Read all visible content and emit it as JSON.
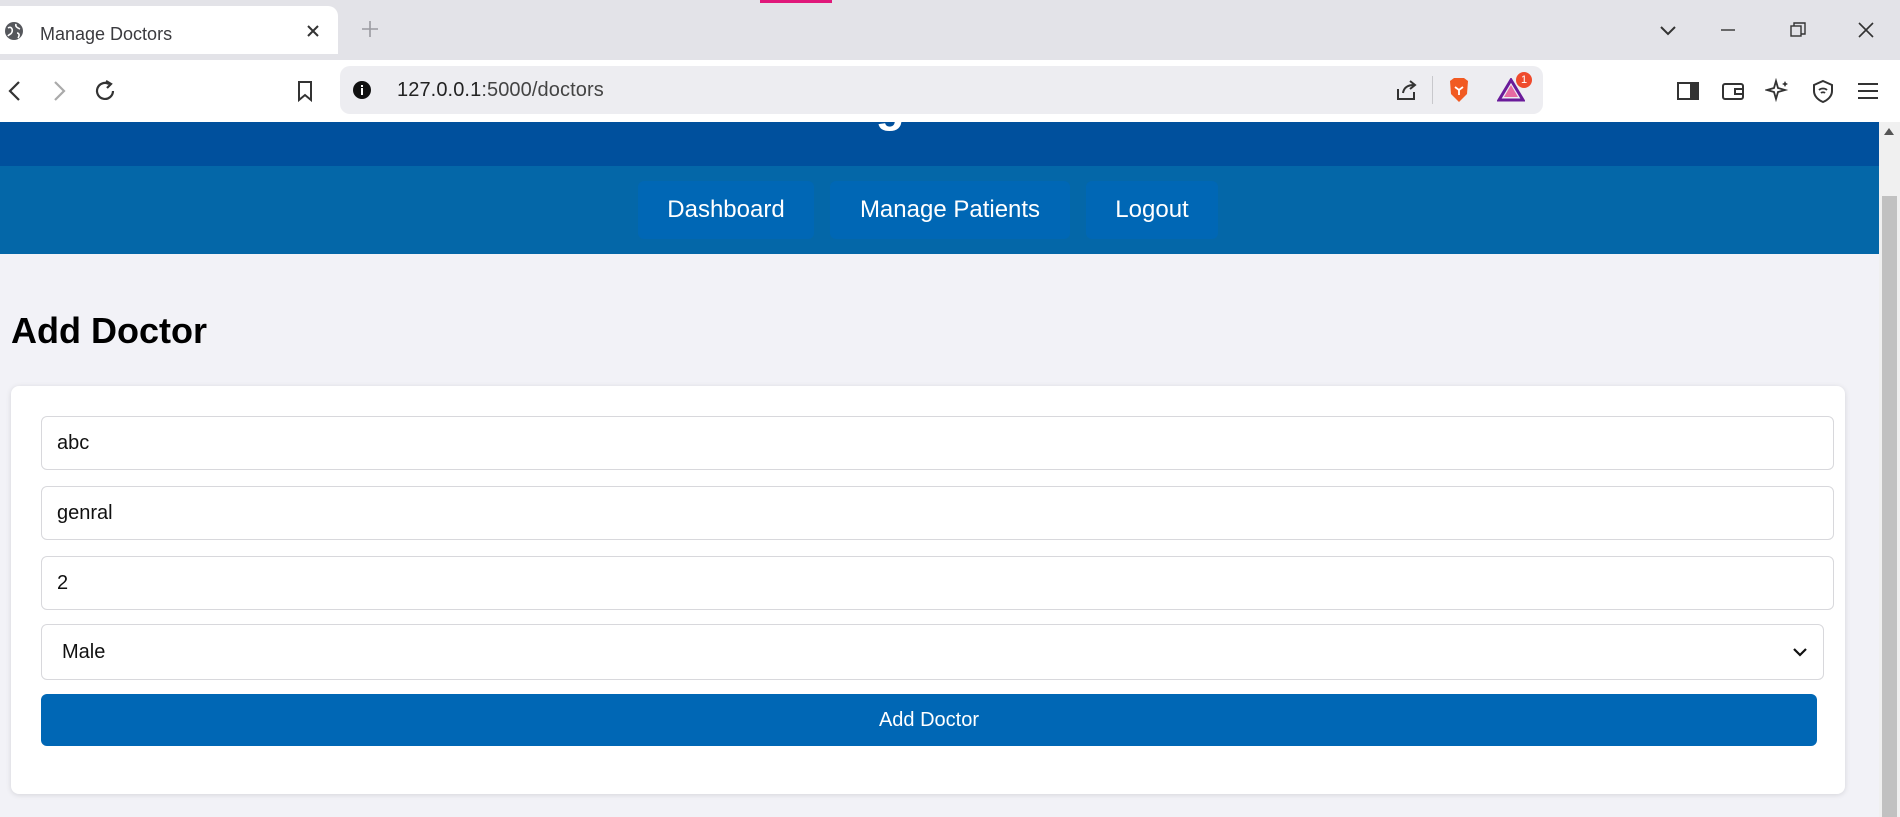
{
  "browser": {
    "tab_title": "Manage Doctors",
    "url_host": "127.0.0.1",
    "url_path": ":5000/doctors",
    "notification_count": "1"
  },
  "page": {
    "header_title": "Manage Doctors",
    "nav": [
      {
        "label": "Dashboard"
      },
      {
        "label": "Manage Patients"
      },
      {
        "label": "Logout"
      }
    ],
    "section_title": "Add Doctor",
    "form": {
      "name_value": "abc",
      "specialization_value": "genral",
      "experience_value": "2",
      "gender_selected": "Male",
      "submit_label": "Add Doctor"
    }
  },
  "colors": {
    "header_dark": "#00509d",
    "nav_bar": "#0467a8",
    "button_blue": "#0067b5",
    "page_bg": "#f2f2f7"
  }
}
